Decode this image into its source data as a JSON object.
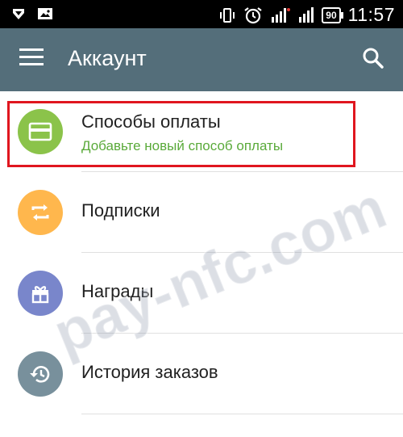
{
  "status_bar": {
    "time": "11:57",
    "battery": "90"
  },
  "app_bar": {
    "title": "Аккаунт"
  },
  "items": [
    {
      "label": "Способы оплаты",
      "sublabel": "Добавьте новый способ оплаты",
      "icon": "credit-card-icon",
      "color": "#8bc34a"
    },
    {
      "label": "Подписки",
      "icon": "repeat-icon",
      "color": "#ffb74d"
    },
    {
      "label": "Награды",
      "icon": "gift-icon",
      "color": "#7986cb"
    },
    {
      "label": "История заказов",
      "icon": "history-icon",
      "color": "#78909c"
    }
  ],
  "watermark": "pay-nfc.com",
  "colors": {
    "appbar": "#546e7a",
    "highlight": "#e0161f",
    "sublabel": "#5aaa3a"
  }
}
